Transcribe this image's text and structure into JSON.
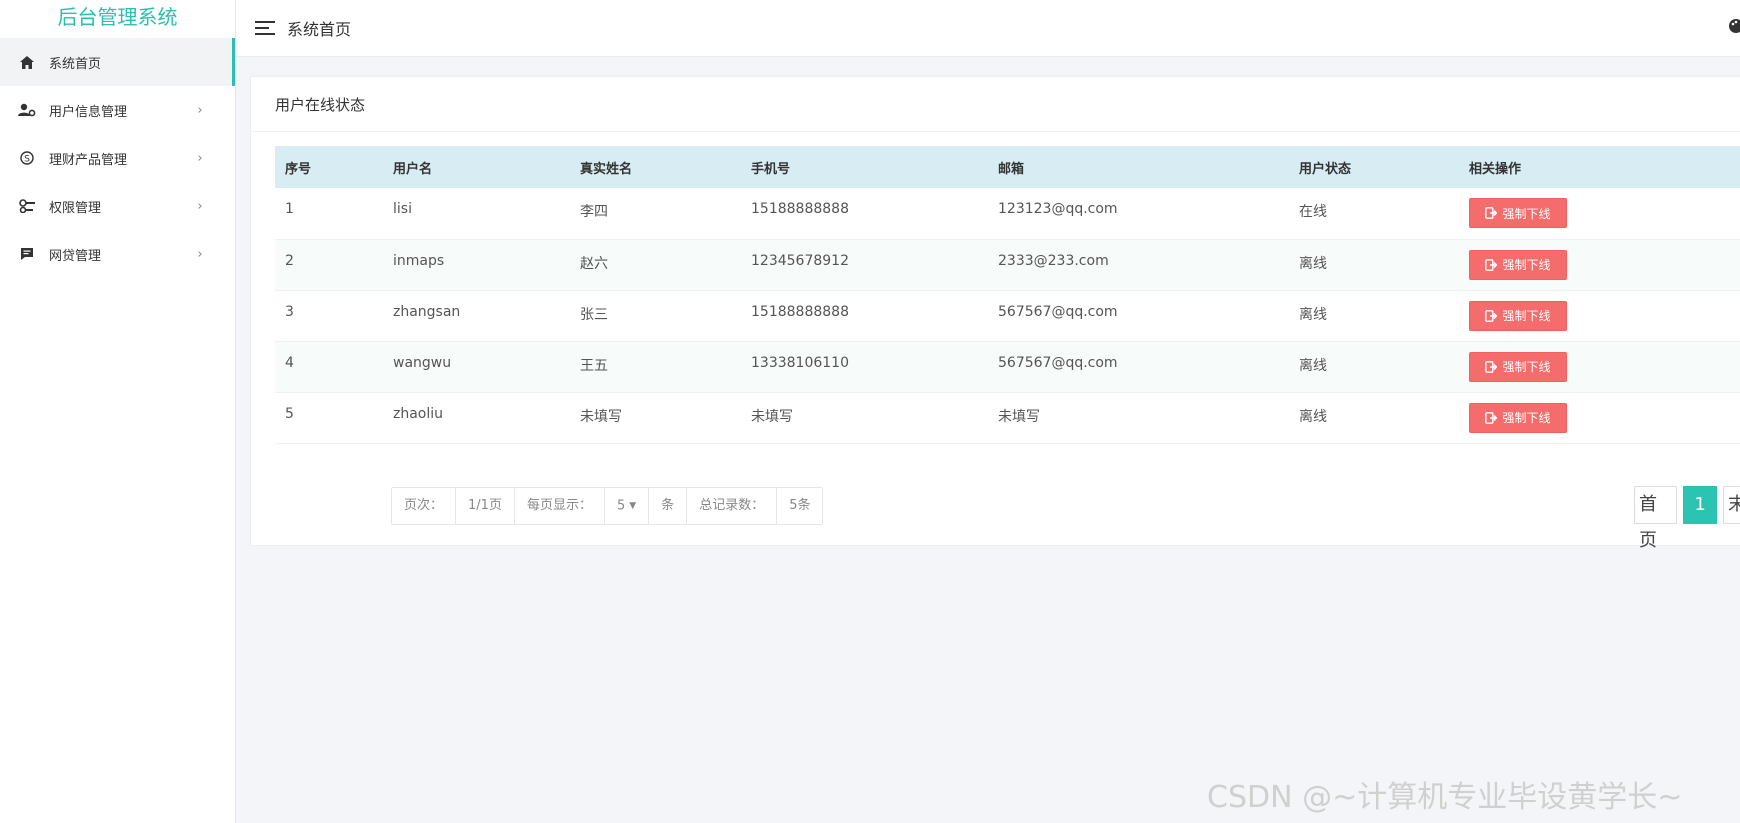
{
  "sidebar": {
    "brand": "后台管理系统",
    "items": [
      {
        "label": "系统首页",
        "icon": "home-icon",
        "active": true
      },
      {
        "label": "用户信息管理",
        "icon": "user-gear-icon",
        "arrow": "›"
      },
      {
        "label": "理财产品管理",
        "icon": "coin-icon",
        "arrow": "›"
      },
      {
        "label": "权限管理",
        "icon": "key-icon",
        "arrow": "›"
      },
      {
        "label": "网贷管理",
        "icon": "message-icon",
        "arrow": "›"
      }
    ]
  },
  "header": {
    "title": "系统首页",
    "menu_icon": "menu-icon",
    "theme_icon": "palette-icon"
  },
  "card": {
    "title": "用户在线状态",
    "columns": [
      "序号",
      "用户名",
      "真实姓名",
      "手机号",
      "邮箱",
      "用户状态",
      "相关操作"
    ],
    "rows": [
      {
        "no": "1",
        "username": "lisi",
        "realname": "李四",
        "phone": "15188888888",
        "email": "123123@qq.com",
        "status": "在线",
        "action": "强制下线"
      },
      {
        "no": "2",
        "username": "inmaps",
        "realname": "赵六",
        "phone": "12345678912",
        "email": "2333@233.com",
        "status": "离线",
        "action": "强制下线"
      },
      {
        "no": "3",
        "username": "zhangsan",
        "realname": "张三",
        "phone": "15188888888",
        "email": "567567@qq.com",
        "status": "离线",
        "action": "强制下线"
      },
      {
        "no": "4",
        "username": "wangwu",
        "realname": "王五",
        "phone": "13338106110",
        "email": "567567@qq.com",
        "status": "离线",
        "action": "强制下线"
      },
      {
        "no": "5",
        "username": "zhaoliu",
        "realname": "未填写",
        "phone": "未填写",
        "email": "未填写",
        "status": "离线",
        "action": "强制下线"
      }
    ]
  },
  "pagination": {
    "page_label": "页次：",
    "page_value": "1/1页",
    "per_page_label": "每页显示：",
    "per_page_value": "5",
    "per_page_unit": "条",
    "total_label": "总记录数：",
    "total_value": "5条",
    "first": "首页",
    "current": "1",
    "last": "末"
  },
  "watermark": "CSDN @~计算机专业毕设黄学长~",
  "colors": {
    "accent": "#2bbfb0",
    "danger": "#f56c6c",
    "table_header": "#d8ecf3"
  }
}
